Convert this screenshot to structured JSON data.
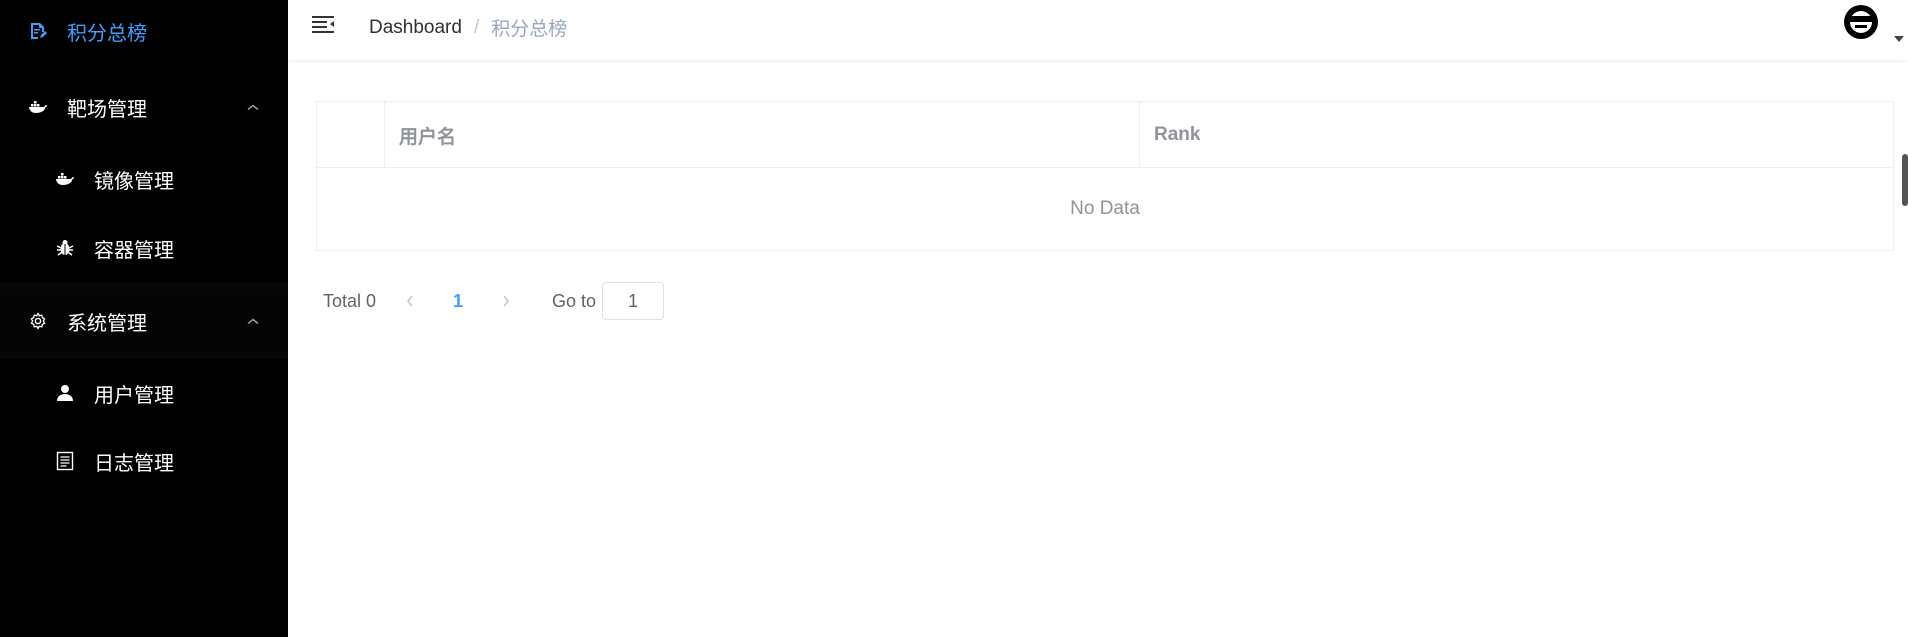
{
  "sidebar": {
    "items": [
      {
        "label": "积分总榜",
        "icon": "document-edit-icon",
        "active": true
      },
      {
        "label": "靶场管理",
        "icon": "docker-icon",
        "expanded": true
      },
      {
        "label": "镜像管理",
        "icon": "docker-icon"
      },
      {
        "label": "容器管理",
        "icon": "bug-icon"
      },
      {
        "label": "系统管理",
        "icon": "gear-icon",
        "expanded": true
      },
      {
        "label": "用户管理",
        "icon": "user-icon"
      },
      {
        "label": "日志管理",
        "icon": "log-icon"
      }
    ],
    "active_color": "#409eff",
    "bg_color": "#000000"
  },
  "navbar": {
    "breadcrumb": {
      "root": "Dashboard",
      "separator": "/",
      "current": "积分总榜"
    }
  },
  "table": {
    "columns": [
      "用户名",
      "Rank"
    ],
    "empty_text": "No Data"
  },
  "pagination": {
    "total_label": "Total 0",
    "current_page": "1",
    "goto_label": "Go to",
    "goto_value": "1"
  }
}
